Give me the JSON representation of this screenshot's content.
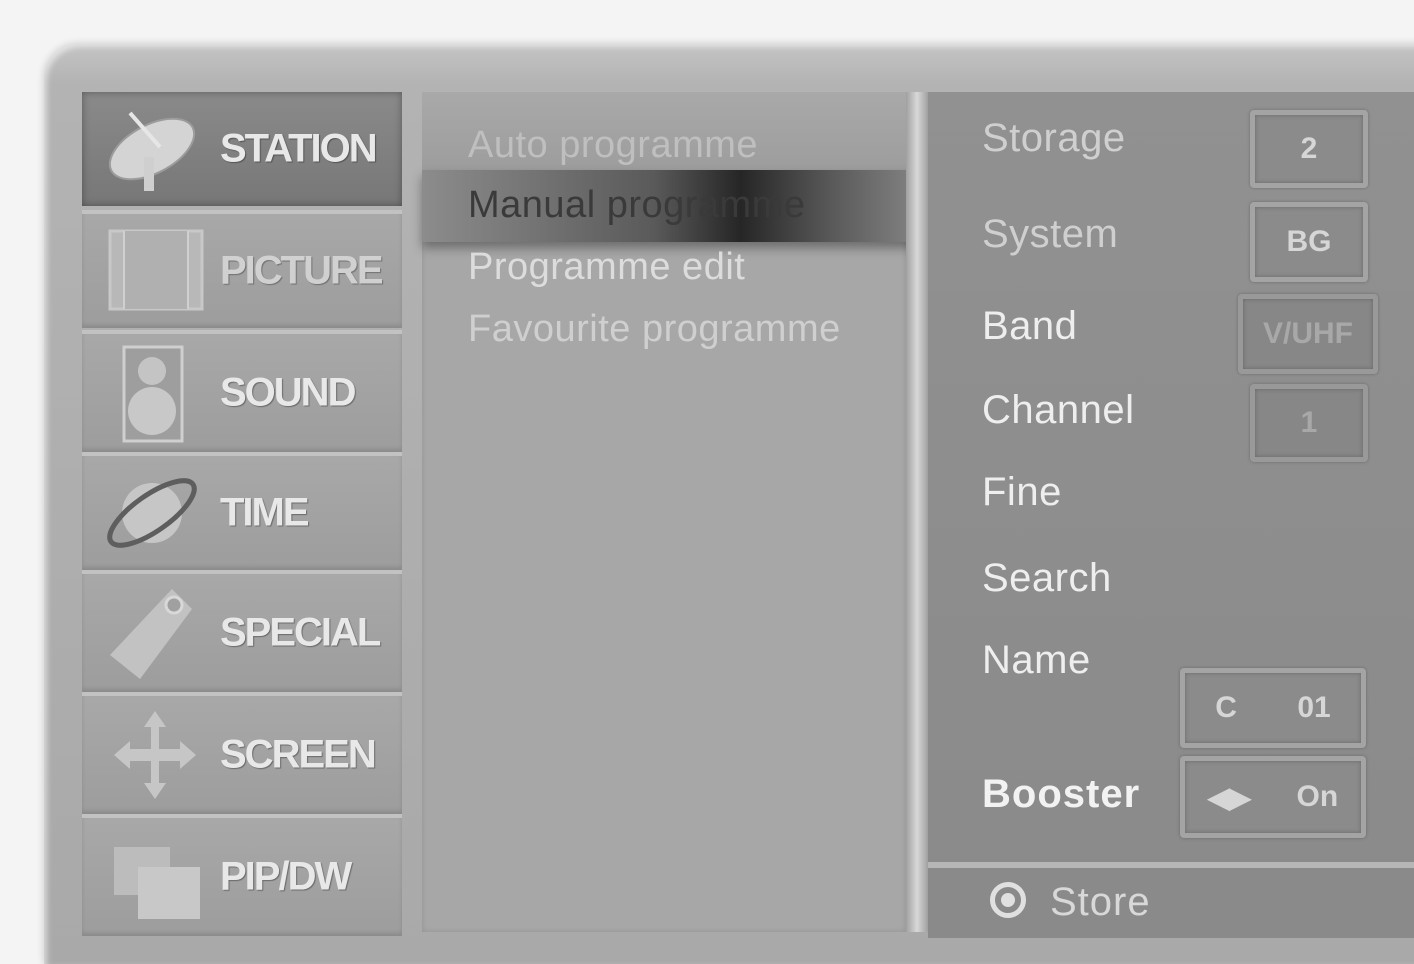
{
  "sidebar": {
    "items": [
      {
        "label": "STATION",
        "icon": "satellite-dish-icon",
        "active": true
      },
      {
        "label": "PICTURE",
        "icon": "film-frame-icon"
      },
      {
        "label": "SOUND",
        "icon": "speaker-icon"
      },
      {
        "label": "TIME",
        "icon": "globe-ring-icon"
      },
      {
        "label": "SPECIAL",
        "icon": "tag-icon"
      },
      {
        "label": "SCREEN",
        "icon": "four-arrows-icon"
      },
      {
        "label": "PIP/DW",
        "icon": "overlapping-windows-icon"
      }
    ]
  },
  "submenu": {
    "items": [
      {
        "label": "Auto programme"
      },
      {
        "label": "Manual programme"
      },
      {
        "label": "Programme edit"
      },
      {
        "label": "Favourite programme"
      }
    ],
    "selected_index": 1
  },
  "settings": {
    "storage": {
      "label": "Storage",
      "value": "2"
    },
    "system": {
      "label": "System",
      "value": "BG"
    },
    "band": {
      "label": "Band",
      "value": "V/UHF"
    },
    "channel": {
      "label": "Channel",
      "value": "1"
    },
    "fine": {
      "label": "Fine"
    },
    "search": {
      "label": "Search"
    },
    "name": {
      "label": "Name",
      "value_prefix": "C",
      "value_num": "01"
    },
    "booster": {
      "label": "Booster",
      "value": "On"
    }
  },
  "footer": {
    "store_label": "Store",
    "store_icon": "ok-button-icon"
  },
  "colors": {
    "panel": "#a9a9a9",
    "active_item": "#7a7a7a",
    "right_panel": "#8e8e8e",
    "text": "#eeeeee"
  }
}
